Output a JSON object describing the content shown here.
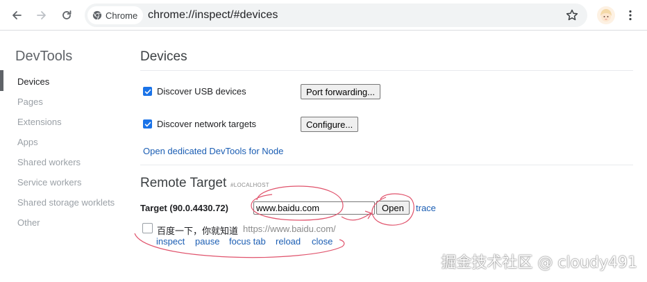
{
  "browser": {
    "chip_label": "Chrome",
    "url": "chrome://inspect/#devices"
  },
  "sidebar": {
    "title": "DevTools",
    "items": [
      {
        "label": "Devices"
      },
      {
        "label": "Pages"
      },
      {
        "label": "Extensions"
      },
      {
        "label": "Apps"
      },
      {
        "label": "Shared workers"
      },
      {
        "label": "Service workers"
      },
      {
        "label": "Shared storage worklets"
      },
      {
        "label": "Other"
      }
    ]
  },
  "devices": {
    "heading": "Devices",
    "usb_label": "Discover USB devices",
    "usb_checked": true,
    "port_forwarding_label": "Port forwarding...",
    "network_label": "Discover network targets",
    "network_checked": true,
    "configure_label": "Configure...",
    "node_link": "Open dedicated DevTools for Node"
  },
  "remote": {
    "heading": "Remote Target",
    "subheading": "#LOCALHOST",
    "target_label": "Target (90.0.4430.72)",
    "url_input_value": "www.baidu.com",
    "open_label": "Open",
    "trace_label": "trace",
    "page": {
      "title": "百度一下，你就知道",
      "url": "https://www.baidu.com/",
      "actions": [
        "inspect",
        "pause",
        "focus tab",
        "reload",
        "close"
      ]
    }
  },
  "watermark": "掘金技术社区 @ cloudy491",
  "colors": {
    "accent": "#1a73e8",
    "link": "#1a5db3",
    "annotation": "#e0526b"
  },
  "icons": [
    "back-arrow-icon",
    "forward-arrow-icon",
    "reload-icon",
    "chrome-logo-icon",
    "star-icon",
    "avatar",
    "more-vert-icon",
    "checkbox-checked-icon"
  ]
}
